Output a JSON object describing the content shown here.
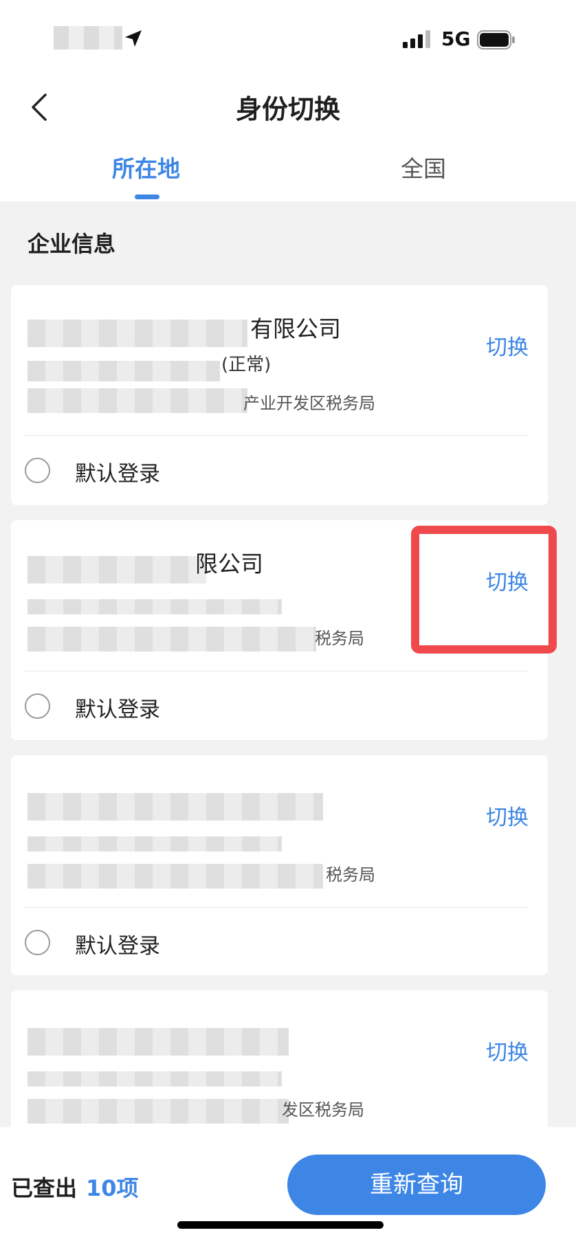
{
  "status_bar": {
    "network": "5G"
  },
  "header": {
    "title": "身份切换"
  },
  "tabs": [
    {
      "label": "所在地",
      "active": true
    },
    {
      "label": "全国",
      "active": false
    }
  ],
  "section": {
    "title": "企业信息"
  },
  "cards": [
    {
      "name_suffix": "有限公司",
      "status_suffix": "(正常)",
      "authority_suffix": "产业开发区税务局",
      "switch_label": "切换",
      "default_login_label": "默认登录"
    },
    {
      "name_suffix": "限公司",
      "status_suffix": "",
      "authority_suffix": "税务局",
      "switch_label": "切换",
      "default_login_label": "默认登录"
    },
    {
      "name_suffix": "",
      "status_suffix": "",
      "authority_suffix": "税务局",
      "switch_label": "切换",
      "default_login_label": "默认登录"
    },
    {
      "name_suffix": "",
      "status_suffix": "",
      "authority_suffix": "发区税务局",
      "switch_label": "切换"
    }
  ],
  "footer": {
    "count_label": "已查出",
    "count_value": "10项",
    "query_button": "重新查询"
  },
  "colors": {
    "accent": "#3d86e6",
    "highlight": "#f0494c",
    "background": "#f2f2f2"
  }
}
